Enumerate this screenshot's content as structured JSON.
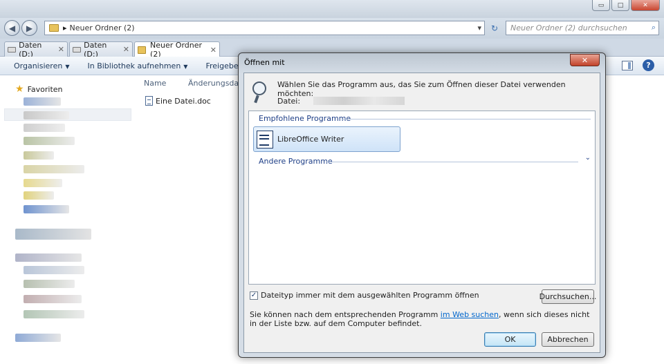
{
  "window": {
    "controls": {
      "minimize": "▭",
      "maximize": "□",
      "close": "✕"
    }
  },
  "addressbar": {
    "back": "◀",
    "forward": "▶",
    "path_separator": "▸",
    "path": "Neuer Ordner (2)",
    "dropdown": "▾",
    "refresh": "↻",
    "search_placeholder": "Neuer Ordner (2) durchsuchen",
    "search_icon": "⌕"
  },
  "tabs": [
    {
      "label": "Daten (D:)",
      "close": "✕"
    },
    {
      "label": "Daten (D:)",
      "close": "✕"
    },
    {
      "label": "Neuer Ordner (2)",
      "close": "✕"
    }
  ],
  "commandbar": {
    "organize": "Organisieren",
    "library": "In Bibliothek aufnehmen",
    "share": "Freigeben fü",
    "arrow": "▼",
    "help": "?"
  },
  "navpane": {
    "favorites": "Favoriten",
    "star": "★"
  },
  "filelist": {
    "col_name": "Name",
    "col_modified": "Änderungsdatu",
    "files": [
      "Eine Datei.doc"
    ]
  },
  "dialog": {
    "title": "Öffnen mit",
    "close": "✕",
    "instruction": "Wählen Sie das Programm aus, das Sie zum Öffnen dieser Datei verwenden möchten:",
    "file_label": "Datei:",
    "recommended_heading": "Empfohlene Programme",
    "recommended_programs": [
      "LibreOffice Writer"
    ],
    "other_heading": "Andere Programme",
    "expand": "⌄",
    "always_use_label": "Dateityp immer mit dem ausgewählten Programm öffnen",
    "always_use_checked": "✓",
    "browse": "Durchsuchen...",
    "hint_before": "Sie können nach dem entsprechenden Programm ",
    "hint_link": "im Web suchen",
    "hint_after": ", wenn sich dieses nicht in der Liste bzw. auf dem Computer befindet.",
    "ok": "OK",
    "cancel": "Abbrechen"
  }
}
